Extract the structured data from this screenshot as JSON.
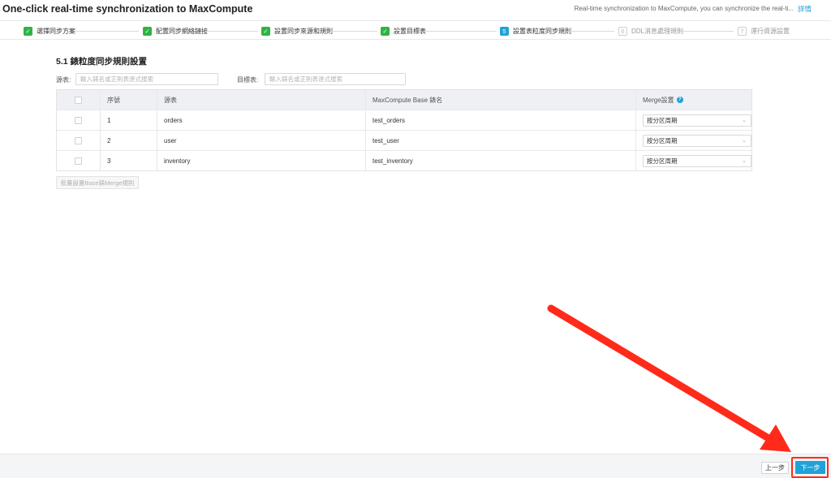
{
  "header": {
    "title": "One-click real-time synchronization to MaxCompute",
    "description": "Real-time synchronization to MaxCompute, you can synchronize the real-ti...",
    "details_link": "詳情"
  },
  "steps": [
    {
      "label": "選擇同步方案",
      "status": "done",
      "mark": "✓"
    },
    {
      "label": "配置同步網絡鏈接",
      "status": "done",
      "mark": "✓"
    },
    {
      "label": "設置同步來源和規則",
      "status": "done",
      "mark": "✓"
    },
    {
      "label": "設置目標表",
      "status": "done",
      "mark": "✓"
    },
    {
      "label": "設置表粒度同步規則",
      "status": "active",
      "mark": "5"
    },
    {
      "label": "DDL消息處理規則",
      "status": "pending",
      "mark": "6"
    },
    {
      "label": "運行資源設置",
      "status": "pending",
      "mark": "7"
    }
  ],
  "section": {
    "title": "5.1 錶粒度同步規則設置"
  },
  "filters": {
    "source_label": "源表:",
    "source_placeholder": "輸入錶名或正則表達式搜索",
    "target_label": "目標表:",
    "target_placeholder": "輸入錶名或正則表達式搜索"
  },
  "table": {
    "headers": {
      "index": "序號",
      "source": "源表",
      "base": "MaxCompute Base 錶名",
      "merge": "Merge設置"
    },
    "rows": [
      {
        "index": "1",
        "source": "orders",
        "base": "test_orders",
        "merge": "按分区周期"
      },
      {
        "index": "2",
        "source": "user",
        "base": "test_user",
        "merge": "按分区周期"
      },
      {
        "index": "3",
        "source": "inventory",
        "base": "test_inventory",
        "merge": "按分区周期"
      }
    ]
  },
  "batch_button": "批量設置Base錶Merge規則",
  "footer": {
    "prev": "上一步",
    "next": "下一步"
  },
  "colors": {
    "accent": "#1fa2d8",
    "done": "#2fb344",
    "highlight": "#ff2a1a"
  }
}
